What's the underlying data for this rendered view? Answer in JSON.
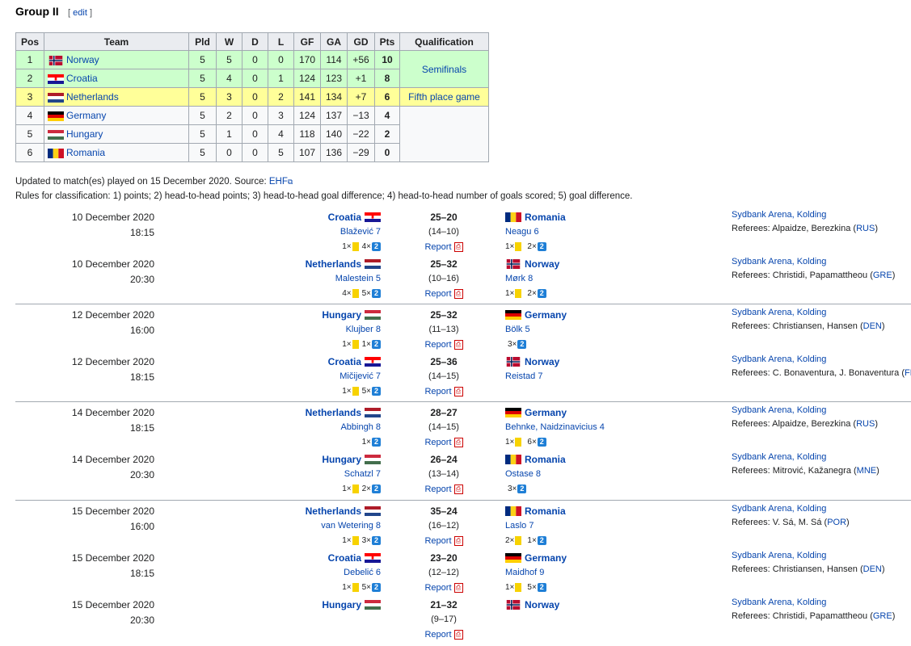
{
  "heading": {
    "title": "Group II",
    "edit_open": "[",
    "edit": "edit",
    "edit_close": "]"
  },
  "colors": {
    "green": "#ccffcc",
    "yellow": "#ffff99",
    "link": "#0645ad"
  },
  "table": {
    "headers": [
      "Pos",
      "Team",
      "Pld",
      "W",
      "D",
      "L",
      "GF",
      "GA",
      "GD",
      "Pts",
      "Qualification"
    ],
    "rows": [
      {
        "pos": "1",
        "team": "Norway",
        "pld": "5",
        "w": "5",
        "d": "0",
        "l": "0",
        "gf": "170",
        "ga": "114",
        "gd": "+56",
        "pts": "10"
      },
      {
        "pos": "2",
        "team": "Croatia",
        "pld": "5",
        "w": "4",
        "d": "0",
        "l": "1",
        "gf": "124",
        "ga": "123",
        "gd": "+1",
        "pts": "8"
      },
      {
        "pos": "3",
        "team": "Netherlands",
        "pld": "5",
        "w": "3",
        "d": "0",
        "l": "2",
        "gf": "141",
        "ga": "134",
        "gd": "+7",
        "pts": "6"
      },
      {
        "pos": "4",
        "team": "Germany",
        "pld": "5",
        "w": "2",
        "d": "0",
        "l": "3",
        "gf": "124",
        "ga": "137",
        "gd": "−13",
        "pts": "4"
      },
      {
        "pos": "5",
        "team": "Hungary",
        "pld": "5",
        "w": "1",
        "d": "0",
        "l": "4",
        "gf": "118",
        "ga": "140",
        "gd": "−22",
        "pts": "2"
      },
      {
        "pos": "6",
        "team": "Romania",
        "pld": "5",
        "w": "0",
        "d": "0",
        "l": "5",
        "gf": "107",
        "ga": "136",
        "gd": "−29",
        "pts": "0"
      }
    ],
    "qual_semis": "Semifinals",
    "qual_fifth": "Fifth place game"
  },
  "notes": {
    "updated": "Updated to match(es) played on 15 December 2020. Source: ",
    "source": "EHF",
    "rules": "Rules for classification: 1) points; 2) head-to-head points; 3) head-to-head goal difference; 4) head-to-head number of goals scored; 5) goal difference."
  },
  "report_label": "Report",
  "matches": [
    {
      "date": "10 December 2020",
      "time": "18:15",
      "home": "Croatia",
      "away": "Romania",
      "score": "25–20",
      "half": "(14–10)",
      "home_scorer": "Blažević 7",
      "away_scorer": "Neagu 6",
      "home_y": "1×",
      "home_t": "4×",
      "away_y": "1×",
      "away_t": "2×",
      "venue": "Sydbank Arena, Kolding",
      "refs_pre": "Referees: Alpaidze, Berezkina (",
      "nat": "RUS",
      "refs_post": ")"
    },
    {
      "date": "10 December 2020",
      "time": "20:30",
      "home": "Netherlands",
      "away": "Norway",
      "score": "25–32",
      "half": "(10–16)",
      "home_scorer": "Malestein 5",
      "away_scorer": "Mørk 8",
      "home_y": "4×",
      "home_t": "5×",
      "away_y": "1×",
      "away_t": "2×",
      "venue": "Sydbank Arena, Kolding",
      "refs_pre": "Referees: Christidi, Papamattheou (",
      "nat": "GRE",
      "refs_post": ")"
    },
    {
      "date": "12 December 2020",
      "time": "16:00",
      "home": "Hungary",
      "away": "Germany",
      "score": "25–32",
      "half": "(11–13)",
      "home_scorer": "Klujber 8",
      "away_scorer": "Bölk 5",
      "home_y": "1×",
      "home_t": "1×",
      "away_y": "",
      "away_t": "3×",
      "venue": "Sydbank Arena, Kolding",
      "refs_pre": "Referees: Christiansen, Hansen (",
      "nat": "DEN",
      "refs_post": ")"
    },
    {
      "date": "12 December 2020",
      "time": "18:15",
      "home": "Croatia",
      "away": "Norway",
      "score": "25–36",
      "half": "(14–15)",
      "home_scorer": "Mičijević 7",
      "away_scorer": "Reistad 7",
      "home_y": "1×",
      "home_t": "5×",
      "away_y": "",
      "away_t": "",
      "venue": "Sydbank Arena, Kolding",
      "refs_pre": "Referees: C. Bonaventura, J. Bonaventura (",
      "nat": "FRA",
      "refs_post": ")"
    },
    {
      "date": "14 December 2020",
      "time": "18:15",
      "home": "Netherlands",
      "away": "Germany",
      "score": "28–27",
      "half": "(14–15)",
      "home_scorer": "Abbingh 8",
      "away_scorer": "Behnke, Naidzinavicius 4",
      "home_y": "",
      "home_t": "1×",
      "away_y": "1×",
      "away_t": "6×",
      "venue": "Sydbank Arena, Kolding",
      "refs_pre": "Referees: Alpaidze, Berezkina (",
      "nat": "RUS",
      "refs_post": ")"
    },
    {
      "date": "14 December 2020",
      "time": "20:30",
      "home": "Hungary",
      "away": "Romania",
      "score": "26–24",
      "half": "(13–14)",
      "home_scorer": "Schatzl 7",
      "away_scorer": "Ostase 8",
      "home_y": "1×",
      "home_t": "2×",
      "away_y": "",
      "away_t": "3×",
      "venue": "Sydbank Arena, Kolding",
      "refs_pre": "Referees: Mitrović, Kažanegra (",
      "nat": "MNE",
      "refs_post": ")"
    },
    {
      "date": "15 December 2020",
      "time": "16:00",
      "home": "Netherlands",
      "away": "Romania",
      "score": "35–24",
      "half": "(16–12)",
      "home_scorer": "van Wetering 8",
      "away_scorer": "Laslo 7",
      "home_y": "1×",
      "home_t": "3×",
      "away_y": "2×",
      "away_t": "1×",
      "venue": "Sydbank Arena, Kolding",
      "refs_pre": "Referees: V. Sá, M. Sá (",
      "nat": "POR",
      "refs_post": ")"
    },
    {
      "date": "15 December 2020",
      "time": "18:15",
      "home": "Croatia",
      "away": "Germany",
      "score": "23–20",
      "half": "(12–12)",
      "home_scorer": "Debelić 6",
      "away_scorer": "Maidhof 9",
      "home_y": "1×",
      "home_t": "5×",
      "away_y": "1×",
      "away_t": "5×",
      "venue": "Sydbank Arena, Kolding",
      "refs_pre": "Referees: Christiansen, Hansen (",
      "nat": "DEN",
      "refs_post": ")"
    },
    {
      "date": "15 December 2020",
      "time": "20:30",
      "home": "Hungary",
      "away": "Norway",
      "score": "21–32",
      "half": "(9–17)",
      "home_scorer": "",
      "away_scorer": "",
      "home_y": "",
      "home_t": "",
      "away_y": "",
      "away_t": "",
      "venue": "Sydbank Arena, Kolding",
      "refs_pre": "Referees: Christidi, Papamattheou (",
      "nat": "GRE",
      "refs_post": ")"
    }
  ]
}
